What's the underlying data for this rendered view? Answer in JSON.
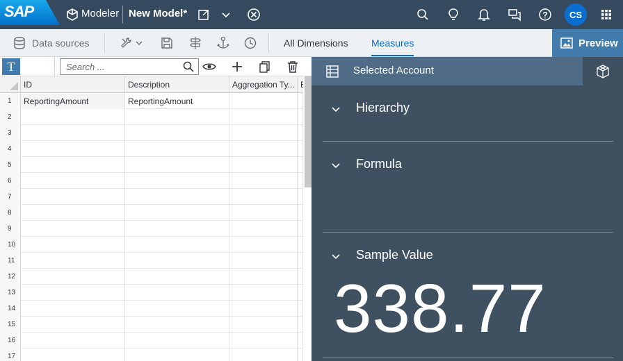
{
  "shell": {
    "logo": "SAP",
    "app_name": "Modeler",
    "model_title": "New Model*",
    "avatar_initials": "CS"
  },
  "toolbar": {
    "data_sources": "Data sources",
    "all_dimensions": "All Dimensions",
    "measures": "Measures",
    "preview": "Preview"
  },
  "grid": {
    "toggle_label": "T",
    "search_placeholder": "Search ...",
    "columns": [
      "ID",
      "Description",
      "Aggregation Ty...",
      "E"
    ],
    "rows": [
      {
        "n": "1",
        "id": "ReportingAmount",
        "desc": "ReportingAmount",
        "agg": ""
      },
      {
        "n": "2",
        "id": "",
        "desc": "",
        "agg": ""
      },
      {
        "n": "3",
        "id": "",
        "desc": "",
        "agg": ""
      },
      {
        "n": "4",
        "id": "",
        "desc": "",
        "agg": ""
      },
      {
        "n": "5",
        "id": "",
        "desc": "",
        "agg": ""
      },
      {
        "n": "6",
        "id": "",
        "desc": "",
        "agg": ""
      },
      {
        "n": "7",
        "id": "",
        "desc": "",
        "agg": ""
      },
      {
        "n": "8",
        "id": "",
        "desc": "",
        "agg": ""
      },
      {
        "n": "9",
        "id": "",
        "desc": "",
        "agg": ""
      },
      {
        "n": "10",
        "id": "",
        "desc": "",
        "agg": ""
      },
      {
        "n": "11",
        "id": "",
        "desc": "",
        "agg": ""
      },
      {
        "n": "12",
        "id": "",
        "desc": "",
        "agg": ""
      },
      {
        "n": "13",
        "id": "",
        "desc": "",
        "agg": ""
      },
      {
        "n": "14",
        "id": "",
        "desc": "",
        "agg": ""
      },
      {
        "n": "15",
        "id": "",
        "desc": "",
        "agg": ""
      },
      {
        "n": "16",
        "id": "",
        "desc": "",
        "agg": ""
      },
      {
        "n": "17",
        "id": "",
        "desc": "",
        "agg": ""
      }
    ]
  },
  "panel": {
    "title": "Selected Account",
    "sections": [
      "Hierarchy",
      "Formula",
      "Sample Value"
    ],
    "sample_value": "338.77"
  },
  "colors": {
    "shell_bg": "#354a5f",
    "panel_bg": "#3f5161",
    "accent": "#427cac",
    "active_tab": "#0a6ed1"
  }
}
